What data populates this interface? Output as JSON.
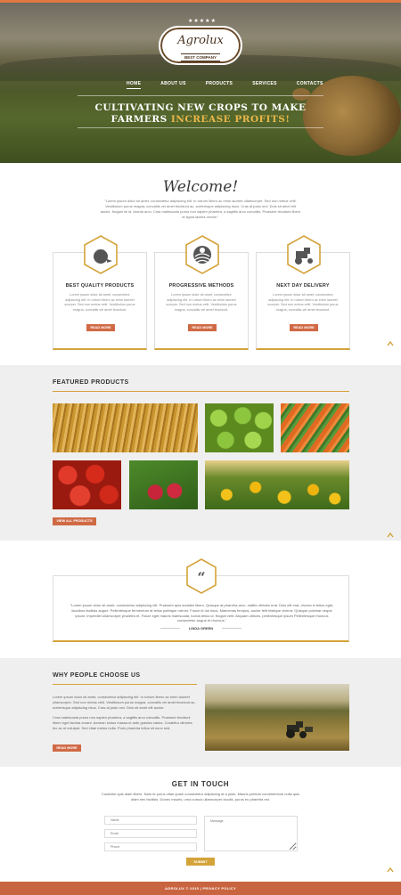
{
  "brand": {
    "stars": "★★★★★",
    "name": "Agrolux",
    "tagline": "BEST COMPANY"
  },
  "nav": [
    {
      "label": "HOME"
    },
    {
      "label": "ABOUT US"
    },
    {
      "label": "PRODUCTS"
    },
    {
      "label": "SERVICES"
    },
    {
      "label": "CONTACTS"
    }
  ],
  "hero": {
    "title_main": "CULTIVATING NEW CROPS TO MAKE FARMERS ",
    "title_highlight": "INCREASE PROFITS!"
  },
  "welcome": {
    "title": "Welcome!",
    "text": "\"Lorem ipsum dolor sit amet, consectetur adipiscing elit. In rutrum libero ac enim laoreet ullamcorper. Sed non metus velit. Vestibulum purus magna, convallis vel amet tincidunt ac, scelerisque adipiscing risus. Cras at justo orci. Duis sit amet elit auctor, feugiat mi id, lacinia arcu. Cras malesuada purus non sapien pharetra, a sagittis arcu convallis. Praesent tincidunt libero at ligula lacinia ornare.\""
  },
  "features": [
    {
      "icon": "tomato-icon",
      "title": "BEST QUALITY PRODUCTS",
      "text": "Lorem ipsum dolor sit amet, consectetur adipiscing elit. In rutrum libero ac enim laoreet scorper. Sed non metus velit. Vestibulum purus magna, convallis vel amet tincidunt.",
      "button": "READ MORE"
    },
    {
      "icon": "field-sun-icon",
      "title": "PROGRESSIVE METHODS",
      "text": "Lorem ipsum dolor sit amet, consectetur adipiscing elit. In rutrum libero ac enim laoreet scorper. Sed non metus velit. Vestibulum purus magna, convallis vel amet tincidunt.",
      "button": "READ MORE"
    },
    {
      "icon": "tractor-icon",
      "title": "NEXT DAY DELIVERY",
      "text": "Lorem ipsum dolor sit amet, consectetur adipiscing elit. In rutrum libero ac enim laoreet scorper. Sed non metus velit. Vestibulum purus magna, convallis vel amet tincidunt.",
      "button": "READ MORE"
    }
  ],
  "featured": {
    "title": "FEATURED PRODUCTS",
    "button": "VIEW ALL PRODUCTS",
    "tiles": [
      "wheat",
      "green-apples",
      "carrots",
      "tomatoes",
      "raspberries",
      "sunflowers"
    ]
  },
  "testimonial": {
    "text": "\"Lorem ipsum dolor sit amet, consectetur adipiscing elit. Praesent quis sodales libero. Quisque at pharetra arcu, mattis ultricies erat. Duis elit erat, viverra in tellus eget, faucibus facilisis augue. Pellentesque fermentum at tellus pathique rutrum. Fusce id dui risus. Maecenas tempus, auctor felit tristique viverra. Quisque pulvinar neque ipsum, imperdiet ullamcorper pharetra et. Fusce eget mauris malesuada, luctus tellus id, feugiat velit. Aliquam ultrices, pellentesque ipsum Pellentesque rhoncus consectetur augue et rhoncus.\"",
    "author": "LINDA GREEN"
  },
  "why": {
    "title": "WHY PEOPLE CHOOSE US",
    "p1": "Lorem ipsum dolor sit amet, consectetur adipiscing elit. In rutrum libero ac enim laoreet ullamcorper. Sed non metus velit. Vestibulum purus magna, convallis vel amet tincidunt ac, scelerisque adipiscing risus. Cras at justo orci. Duis sit amet elit auctor.",
    "p2": "Cras malesuada purus non sapien pharetra, a sagittis arcu convallis. Praesent tincidunt libero eget lacinia ornare. Aenean luctus massa ut ante gravida varius. Curabitur ultricies leo ac ut volutpat. Sed vitae metus nulla. Proin pharetra tellus sit nunc sed.",
    "button": "READ MORE"
  },
  "contact": {
    "title": "GET IN TOUCH",
    "text": "Curabitur quis diam libero. Nam et purus vitae quam consectetur adipiscing at a justo. Mauris pretium condimentum nulla quis diam nec facilisis. Donec mauris, urna cursus ullamcorper iaculis, purus eu pharetra est.",
    "name_ph": "Name",
    "email_ph": "Email",
    "phone_ph": "Phone",
    "message_ph": "Message",
    "submit": "SUBMIT"
  },
  "footer": {
    "text": "AGROLUX © 2015 | PRIVACY POLICY"
  },
  "colors": {
    "accent": "#d4a33a",
    "button": "#d06a45",
    "footer": "#c8643f"
  }
}
